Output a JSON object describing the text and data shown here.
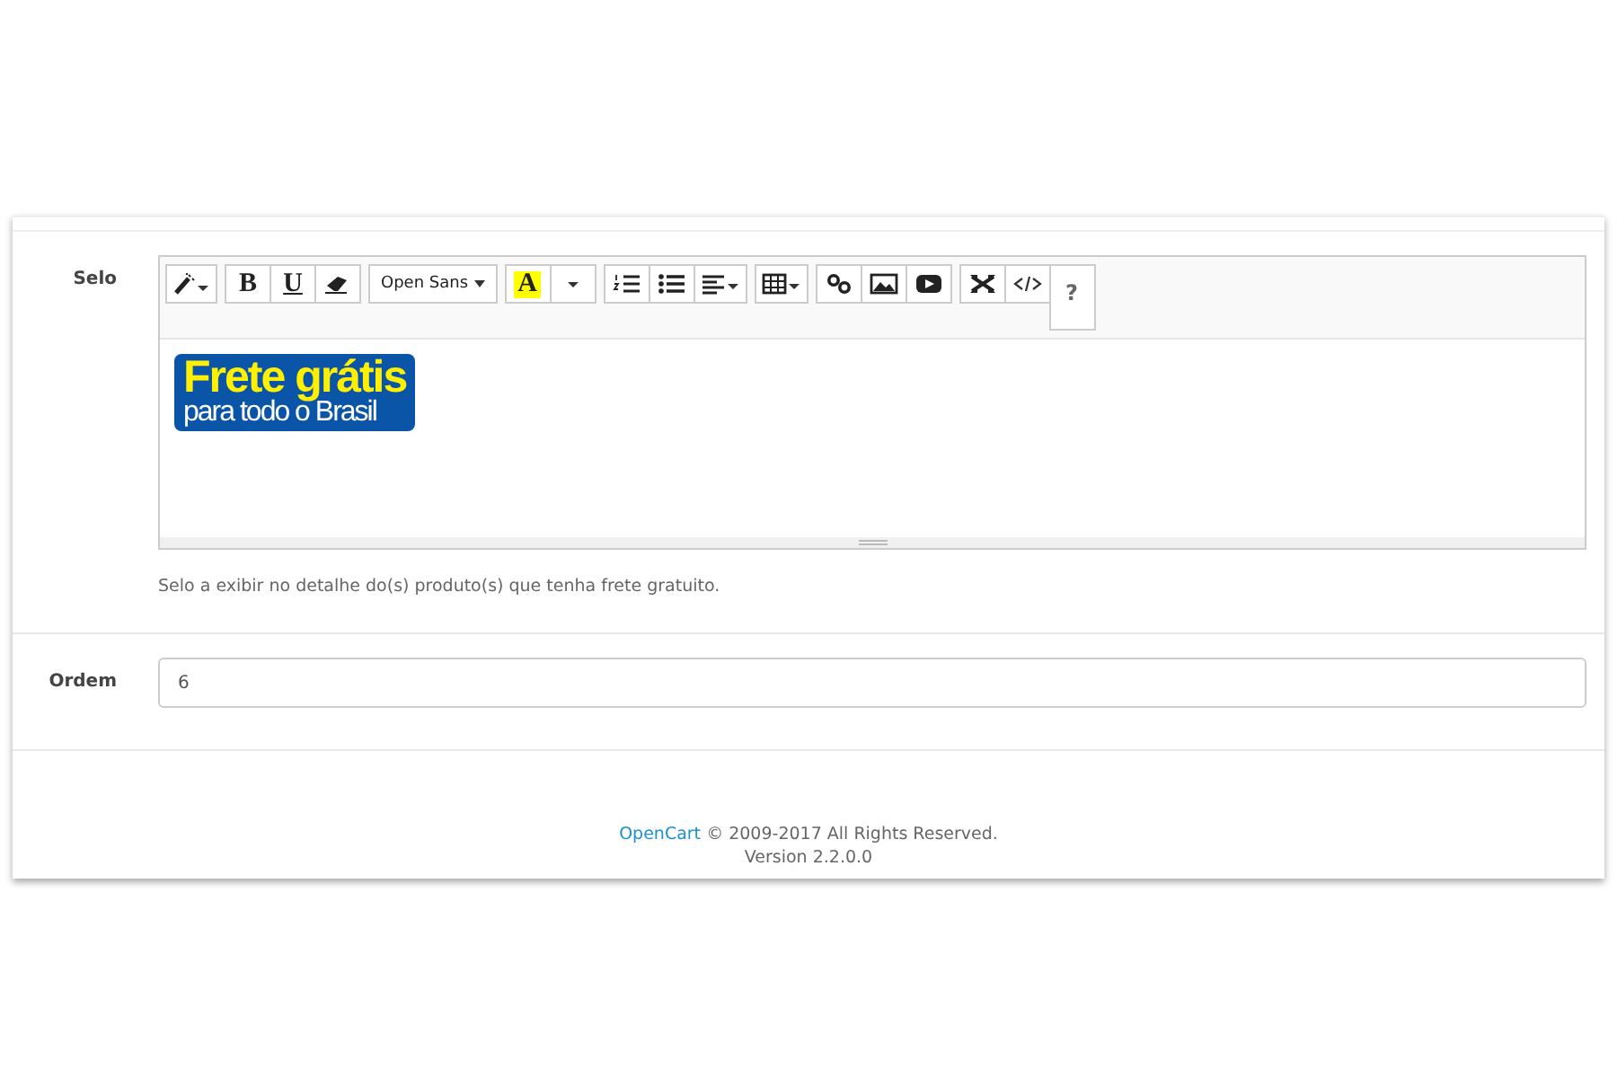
{
  "form": [
    {
      "kind": "editor",
      "label": "Selo",
      "toolbar": [
        [
          {
            "kind": "wand"
          }
        ],
        [
          {
            "kind": "bold",
            "label": "B"
          },
          {
            "kind": "underline",
            "label": "U"
          },
          {
            "kind": "eraser"
          }
        ],
        [
          {
            "kind": "font",
            "label": "Open Sans"
          }
        ],
        [
          {
            "kind": "color",
            "label": "A"
          },
          {
            "kind": "caret"
          }
        ],
        [
          {
            "kind": "ol"
          },
          {
            "kind": "ul"
          },
          {
            "kind": "align"
          }
        ],
        [
          {
            "kind": "table"
          }
        ],
        [
          {
            "kind": "link"
          },
          {
            "kind": "image"
          },
          {
            "kind": "video"
          }
        ],
        [
          {
            "kind": "fullscreen"
          },
          {
            "kind": "code"
          },
          {
            "kind": "help",
            "label": "?"
          }
        ]
      ],
      "banner": {
        "title": "Frete grátis",
        "subtitle": "para todo o Brasil"
      },
      "help": "Selo a exibir no detalhe do(s) produto(s) que tenha frete gratuito."
    },
    {
      "kind": "input",
      "label": "Ordem",
      "value": "6"
    }
  ],
  "footer": {
    "link": "OpenCart",
    "text": "© 2009-2017 All Rights Reserved.",
    "version": "Version 2.2.0.0"
  }
}
